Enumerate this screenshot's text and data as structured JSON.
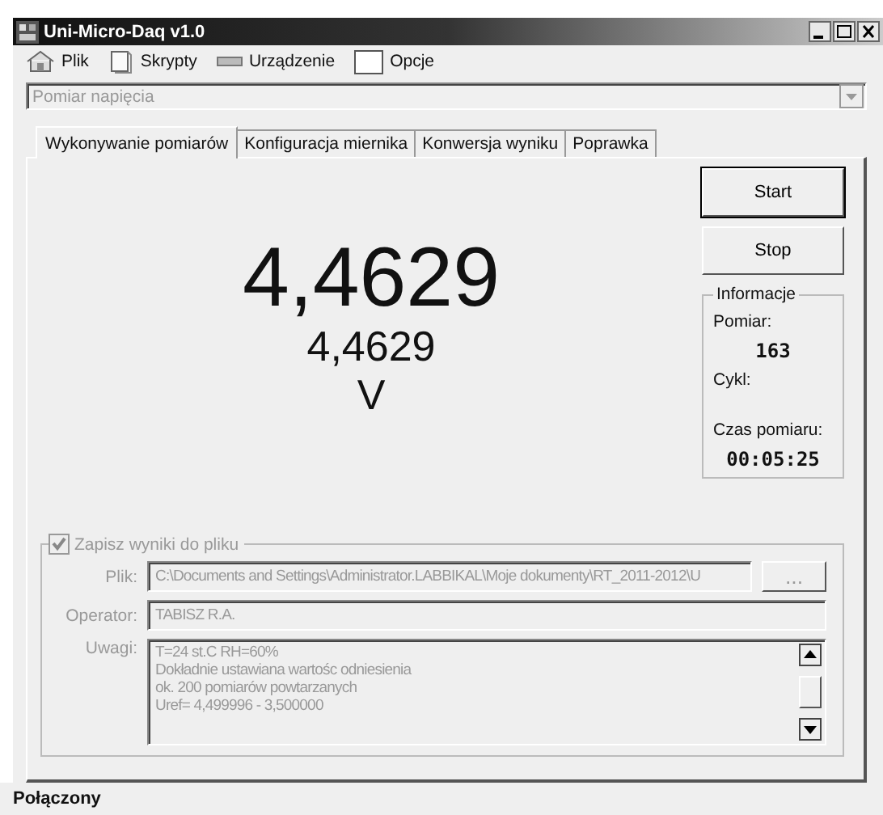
{
  "window": {
    "title": "Uni-Micro-Daq v1.0"
  },
  "menu": [
    {
      "label": "Plik"
    },
    {
      "label": "Skrypty"
    },
    {
      "label": "Urządzenie"
    },
    {
      "label": "Opcje"
    }
  ],
  "mode_select": {
    "value": "Pomiar napięcia",
    "disabled": true
  },
  "tabs": [
    {
      "label": "Wykonywanie pomiarów",
      "selected": true
    },
    {
      "label": "Konfiguracja miernika",
      "selected": false
    },
    {
      "label": "Konwersja wyniku",
      "selected": false
    },
    {
      "label": "Poprawka",
      "selected": false
    }
  ],
  "reading": {
    "main": "4,4629",
    "secondary": "4,4629",
    "unit": "V"
  },
  "buttons": [
    {
      "label": "Start",
      "default": true
    },
    {
      "label": "Stop",
      "default": false
    }
  ],
  "info": {
    "title": "Informacje",
    "fields": [
      {
        "label": "Pomiar:",
        "value": "163"
      },
      {
        "label": "Cykl:"
      },
      {
        "label": "Czas pomiaru:",
        "value": "00:05:25"
      }
    ]
  },
  "file_group": {
    "label": "Zapisz wyniki do pliku",
    "checked": true,
    "disabled": true,
    "file": {
      "label": "Plik:",
      "value": "C:\\Documents and Settings\\Administrator.LABBIKAL\\Moje dokumenty\\RT_2011-2012\\U",
      "browse": "..."
    },
    "operator": {
      "label": "Operator:",
      "value": "TABISZ R.A."
    },
    "notes": {
      "label": "Uwagi:",
      "lines": [
        "T=24 st.C  RH=60%",
        "Dokładnie ustawiana wartośc odniesienia",
        "ok. 200 pomiarów powtarzanych",
        "Uref= 4,499996 - 3,500000"
      ]
    }
  },
  "status_bar": {
    "text": "Połączony"
  }
}
